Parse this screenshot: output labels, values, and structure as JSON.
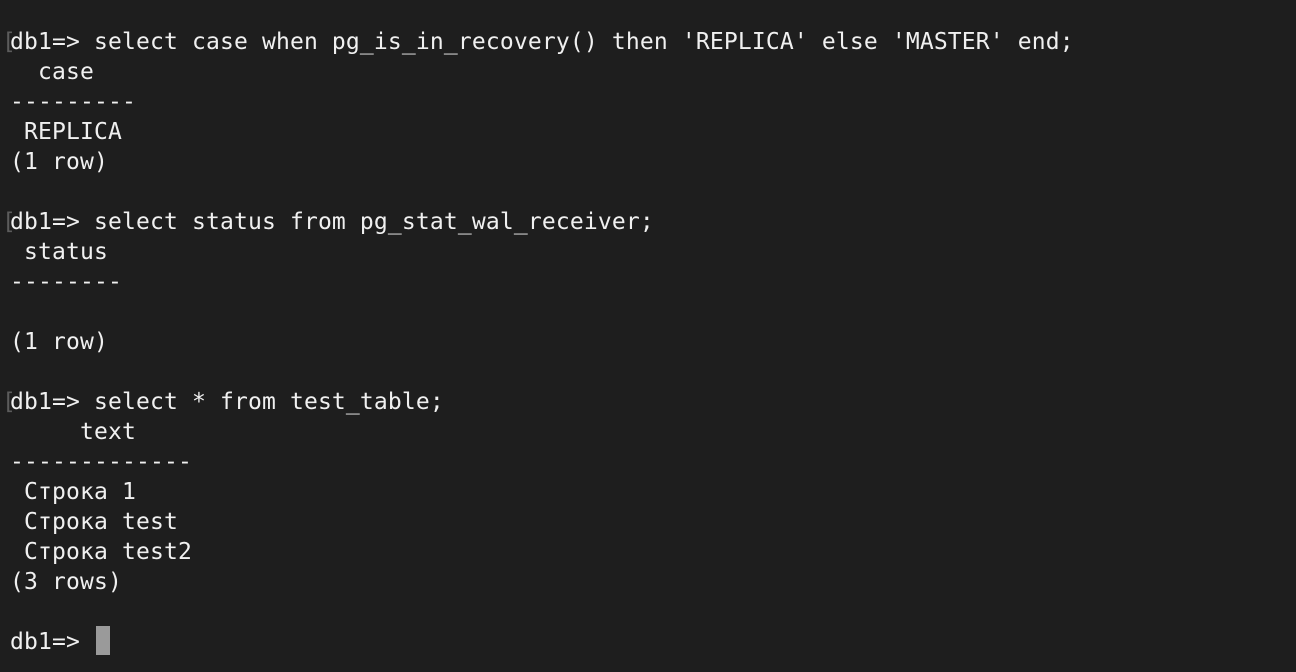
{
  "terminal": {
    "lines": [
      {
        "text": "db1=> select case when pg_is_in_recovery() then 'REPLICA' else 'MASTER' end;",
        "bracket": "["
      },
      {
        "text": "  case"
      },
      {
        "text": "---------"
      },
      {
        "text": " REPLICA"
      },
      {
        "text": "(1 row)"
      },
      {
        "text": ""
      },
      {
        "text": "db1=> select status from pg_stat_wal_receiver;",
        "bracket": "["
      },
      {
        "text": " status"
      },
      {
        "text": "--------"
      },
      {
        "text": ""
      },
      {
        "text": "(1 row)"
      },
      {
        "text": ""
      },
      {
        "text": "db1=> select * from test_table;",
        "bracket": "["
      },
      {
        "text": "     text"
      },
      {
        "text": "-------------"
      },
      {
        "text": " Строка 1"
      },
      {
        "text": " Строка test"
      },
      {
        "text": " Строка test2"
      },
      {
        "text": "(3 rows)"
      },
      {
        "text": ""
      }
    ],
    "prompt": "db1=> "
  }
}
